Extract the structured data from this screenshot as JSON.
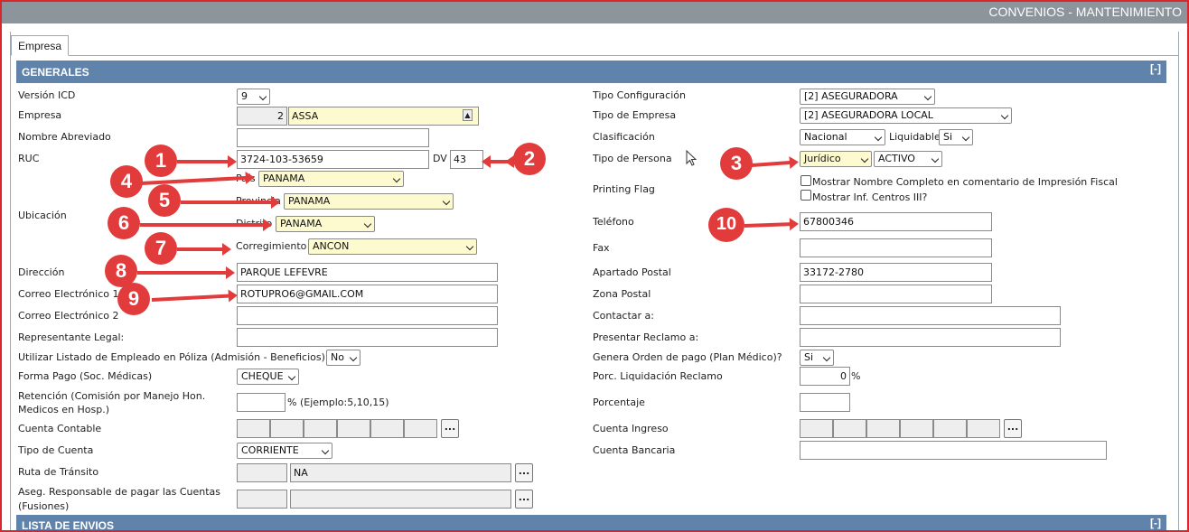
{
  "window": {
    "title": "CONVENIOS - MANTENIMIENTO"
  },
  "tabs": [
    {
      "label": "Empresa"
    }
  ],
  "sections": {
    "generales": {
      "title": "GENERALES",
      "toggle": "[-]"
    },
    "lista_envios": {
      "title": "LISTA DE ENVIOS",
      "toggle": "[-]"
    }
  },
  "left": {
    "version_icd": {
      "label": "Versión ICD",
      "value": "9"
    },
    "empresa": {
      "label": "Empresa",
      "code": "2",
      "name": "ASSA"
    },
    "nombre_abreviado": {
      "label": "Nombre Abreviado",
      "value": ""
    },
    "ruc": {
      "label": "RUC",
      "value": "3724-103-53659",
      "dv_label": "DV",
      "dv_value": "43"
    },
    "ubicacion": {
      "label": "Ubicación",
      "pais_label": "País",
      "pais_value": "PANAMA",
      "provincia_label": "Provincia",
      "provincia_value": "PANAMA",
      "distrito_label": "Distrito",
      "distrito_value": "PANAMA",
      "corregimiento_label": "Corregimiento",
      "corregimiento_value": "ANCON"
    },
    "direccion": {
      "label": "Dirección",
      "value": "PARQUE LEFEVRE"
    },
    "correo1": {
      "label": "Correo Electrónico 1",
      "value": "ROTUPRO6@GMAIL.COM"
    },
    "correo2": {
      "label": "Correo Electrónico 2",
      "value": ""
    },
    "representante": {
      "label": "Representante Legal:",
      "value": ""
    },
    "listado_empleado": {
      "label": "Utilizar Listado de Empleado en Póliza (Admisión - Beneficios):",
      "value": "No"
    },
    "forma_pago": {
      "label": "Forma Pago (Soc. Médicas)",
      "value": "CHEQUE"
    },
    "retencion": {
      "label_line1": "Retención (Comisión por Manejo Hon.",
      "label_line2": "Medicos en Hosp.)",
      "value": "",
      "suffix": "% (Ejemplo:5,10,15)"
    },
    "cuenta_contable": {
      "label": "Cuenta Contable",
      "button": "..."
    },
    "tipo_cuenta": {
      "label": "Tipo de Cuenta",
      "value": "CORRIENTE"
    },
    "ruta_transito": {
      "label": "Ruta de Tránsito",
      "code": "",
      "name": "NA",
      "button": "..."
    },
    "aseg_responsable": {
      "label_line1": "Aseg. Responsable de pagar las Cuentas",
      "label_line2": "(Fusiones)",
      "code": "",
      "name": "",
      "button": "..."
    }
  },
  "right": {
    "tipo_configuracion": {
      "label": "Tipo Configuración",
      "value": "[2] ASEGURADORA"
    },
    "tipo_empresa": {
      "label": "Tipo de Empresa",
      "value": "[2] ASEGURADORA LOCAL"
    },
    "clasificacion": {
      "label": "Clasificación",
      "value": "Nacional",
      "liquidable_label": "Liquidable",
      "liquidable_value": "Si"
    },
    "tipo_persona": {
      "label": "Tipo de Persona",
      "value": "Jurídico",
      "estado_value": "ACTIVO"
    },
    "printing_flag": {
      "label": "Printing Flag",
      "opt1": "Mostrar Nombre Completo en comentario de Impresión Fiscal",
      "opt2": "Mostrar Inf. Centros III?"
    },
    "telefono": {
      "label": "Teléfono",
      "value": "67800346"
    },
    "fax": {
      "label": "Fax",
      "value": ""
    },
    "apartado": {
      "label": "Apartado Postal",
      "value": "33172-2780"
    },
    "zona_postal": {
      "label": "Zona Postal",
      "value": ""
    },
    "contactar": {
      "label": "Contactar a:",
      "value": ""
    },
    "presentar_reclamo": {
      "label": "Presentar Reclamo a:",
      "value": ""
    },
    "genera_orden": {
      "label": "Genera Orden de pago (Plan Médico)?",
      "value": "Si"
    },
    "porc_liquidacion": {
      "label": "Porc. Liquidación Reclamo",
      "value": "0",
      "suffix": "%"
    },
    "porcentaje": {
      "label": "Porcentaje",
      "value": ""
    },
    "cuenta_ingreso": {
      "label": "Cuenta Ingreso",
      "button": "..."
    },
    "cuenta_bancaria": {
      "label": "Cuenta Bancaria",
      "value": ""
    }
  },
  "annotations": [
    "1",
    "2",
    "3",
    "4",
    "5",
    "6",
    "7",
    "8",
    "9",
    "10"
  ],
  "colors": {
    "section_header": "#5f83aa",
    "required_field": "#fdfad0",
    "annotation_red": "#e23b3b",
    "titlebar": "#8c949c"
  }
}
